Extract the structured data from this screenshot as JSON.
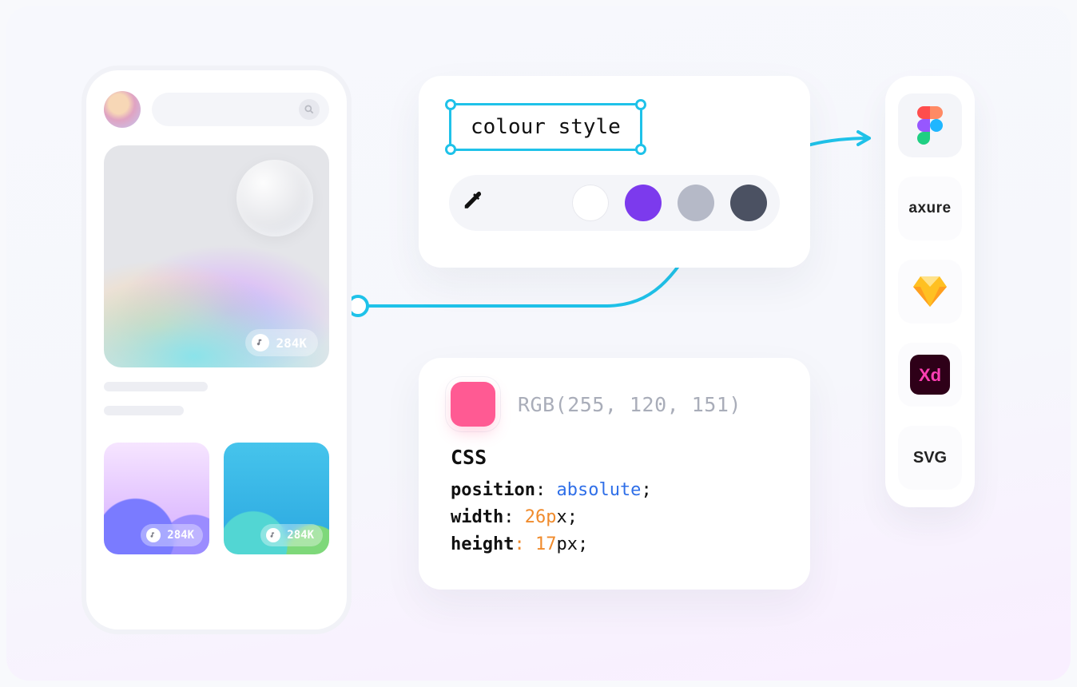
{
  "phone": {
    "hero_count": "284K",
    "thumb_a_count": "284K",
    "thumb_b_count": "284K"
  },
  "style_panel": {
    "selection_label": "colour style",
    "swatches": [
      "#ffffff",
      "#7c3aed",
      "#b5b9c7",
      "#4b5162"
    ]
  },
  "code_panel": {
    "rgb_text": "RGB(255, 120, 151)",
    "chip_color": "#ff5a93",
    "css_heading": "CSS",
    "lines": {
      "l1_kw": "position",
      "l1_val": "absolute",
      "l2_kw": "width",
      "l2_num": "26p",
      "l2_rest": "x;",
      "l3_kw": "height",
      "l3_num": "17",
      "l3_rest": "px;"
    }
  },
  "tools": {
    "figma": "Figma",
    "axure": "axure",
    "sketch": "Sketch",
    "xd": "Xd",
    "svg": "SVG"
  }
}
